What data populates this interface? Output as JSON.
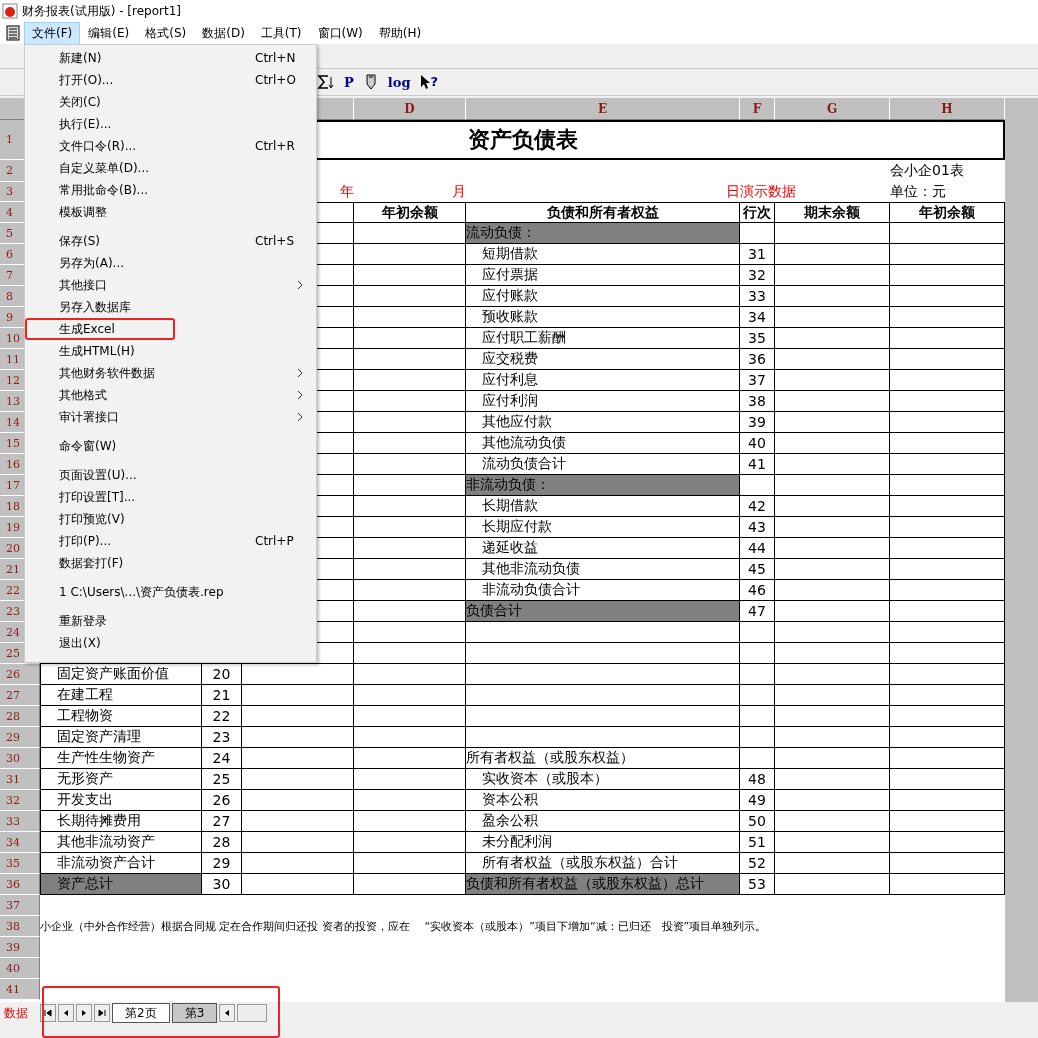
{
  "window": {
    "title": "财务报表(试用版) - [report1]"
  },
  "menubar": [
    {
      "label": "文件(F)",
      "selected": true
    },
    {
      "label": "编辑(E)",
      "selected": false
    },
    {
      "label": "格式(S)",
      "selected": false
    },
    {
      "label": "数据(D)",
      "selected": false
    },
    {
      "label": "工具(T)",
      "selected": false
    },
    {
      "label": "窗口(W)",
      "selected": false
    },
    {
      "label": "帮助(H)",
      "selected": false
    }
  ],
  "toolbar": [
    {
      "kind": "sort"
    },
    {
      "kind": "text",
      "label": "P"
    },
    {
      "kind": "pin"
    },
    {
      "kind": "text",
      "label": "log"
    },
    {
      "kind": "help",
      "label": "?"
    }
  ],
  "file_menu": {
    "groups": [
      [
        {
          "label": "新建(N)",
          "shortcut": "Ctrl+N",
          "submenu": false,
          "annotated": false
        },
        {
          "label": "打开(O)...",
          "shortcut": "Ctrl+O",
          "submenu": false,
          "annotated": false
        },
        {
          "label": "关闭(C)",
          "submenu": false,
          "annotated": false
        },
        {
          "label": "执行(E)...",
          "submenu": false,
          "annotated": false
        },
        {
          "label": "文件口令(R)...",
          "shortcut": "Ctrl+R",
          "submenu": false,
          "annotated": false
        },
        {
          "label": "自定义菜单(D)...",
          "submenu": false,
          "annotated": false
        },
        {
          "label": "常用批命令(B)...",
          "submenu": false,
          "annotated": false
        },
        {
          "label": "模板调整",
          "submenu": false,
          "annotated": false
        }
      ],
      [
        {
          "label": "保存(S)",
          "shortcut": "Ctrl+S",
          "submenu": false,
          "annotated": false
        },
        {
          "label": "另存为(A)...",
          "submenu": false,
          "annotated": false
        },
        {
          "label": "其他接口",
          "submenu": true,
          "annotated": false
        },
        {
          "label": "另存入数据库",
          "submenu": false,
          "annotated": false
        },
        {
          "label": "生成Excel",
          "submenu": false,
          "annotated": true
        },
        {
          "label": "生成HTML(H)",
          "submenu": false,
          "annotated": false
        },
        {
          "label": "其他财务软件数据",
          "submenu": true,
          "annotated": false
        },
        {
          "label": "其他格式",
          "submenu": true,
          "annotated": false
        },
        {
          "label": "审计署接口",
          "submenu": true,
          "annotated": false
        }
      ],
      [
        {
          "label": "命令窗(W)",
          "submenu": false,
          "annotated": false
        }
      ],
      [
        {
          "label": "页面设置(U)...",
          "submenu": false,
          "annotated": false
        },
        {
          "label": "打印设置[T]...",
          "submenu": false,
          "annotated": false
        },
        {
          "label": "打印预览(V)",
          "submenu": false,
          "annotated": false
        },
        {
          "label": "打印(P)...",
          "shortcut": "Ctrl+P",
          "submenu": false,
          "annotated": false
        },
        {
          "label": "数据套打(F)",
          "submenu": false,
          "annotated": false
        }
      ],
      [
        {
          "label": "1 C:\\Users\\...\\资产负债表.rep",
          "submenu": false,
          "annotated": false
        }
      ],
      [
        {
          "label": "重新登录",
          "submenu": false,
          "annotated": false
        },
        {
          "label": "退出(X)",
          "submenu": false,
          "annotated": false
        }
      ]
    ]
  },
  "sheet": {
    "column_headers": [
      "D",
      "E",
      "F",
      "G",
      "H"
    ],
    "rows": [
      {
        "number": "1",
        "kind": "title",
        "text": "资产负债表"
      },
      {
        "number": "2",
        "kind": "info",
        "h": "会小企01表"
      },
      {
        "number": "3",
        "kind": "date",
        "c": "年",
        "d": "月",
        "e": "日",
        "f": "演示数据",
        "h": "单位：元"
      },
      {
        "number": "4",
        "kind": "header",
        "d": "年初余额",
        "e": "负债和所有者权益",
        "f": "行次",
        "g": "期末余额",
        "h": "年初余额"
      },
      {
        "number": "5",
        "kind": "data",
        "right": {
          "label": "流动负债：",
          "kind": "section"
        }
      },
      {
        "number": "6",
        "kind": "data",
        "right": {
          "label": "短期借款",
          "line": "31",
          "kind": "item"
        }
      },
      {
        "number": "7",
        "kind": "data",
        "right": {
          "label": "应付票据",
          "line": "32",
          "kind": "item"
        }
      },
      {
        "number": "8",
        "kind": "data",
        "right": {
          "label": "应付账款",
          "line": "33",
          "kind": "item"
        }
      },
      {
        "number": "9",
        "kind": "data",
        "right": {
          "label": "预收账款",
          "line": "34",
          "kind": "item"
        }
      },
      {
        "number": "10",
        "kind": "data",
        "right": {
          "label": "应付职工薪酬",
          "line": "35",
          "kind": "item"
        }
      },
      {
        "number": "11",
        "kind": "data",
        "right": {
          "label": "应交税费",
          "line": "36",
          "kind": "item"
        }
      },
      {
        "number": "12",
        "kind": "data",
        "right": {
          "label": "应付利息",
          "line": "37",
          "kind": "item"
        }
      },
      {
        "number": "13",
        "kind": "data",
        "right": {
          "label": "应付利润",
          "line": "38",
          "kind": "item"
        }
      },
      {
        "number": "14",
        "kind": "data",
        "right": {
          "label": "其他应付款",
          "line": "39",
          "kind": "item"
        }
      },
      {
        "number": "15",
        "kind": "data",
        "right": {
          "label": "其他流动负债",
          "line": "40",
          "kind": "item"
        }
      },
      {
        "number": "16",
        "kind": "data",
        "right": {
          "label": "流动负债合计",
          "line": "41",
          "kind": "item"
        }
      },
      {
        "number": "17",
        "kind": "data",
        "right": {
          "label": "非流动负债：",
          "kind": "section"
        }
      },
      {
        "number": "18",
        "kind": "data",
        "right": {
          "label": "长期借款",
          "line": "42",
          "kind": "item"
        }
      },
      {
        "number": "19",
        "kind": "data",
        "right": {
          "label": "长期应付款",
          "line": "43",
          "kind": "item"
        }
      },
      {
        "number": "20",
        "kind": "data",
        "right": {
          "label": "递延收益",
          "line": "44",
          "kind": "item"
        }
      },
      {
        "number": "21",
        "kind": "data",
        "right": {
          "label": "其他非流动负债",
          "line": "45",
          "kind": "item"
        }
      },
      {
        "number": "22",
        "kind": "data",
        "right": {
          "label": "非流动负债合计",
          "line": "46",
          "kind": "item"
        }
      },
      {
        "number": "23",
        "kind": "data",
        "right": {
          "label": "负债合计",
          "line": "47",
          "kind": "section"
        }
      },
      {
        "number": "24",
        "kind": "data"
      },
      {
        "number": "25",
        "kind": "data"
      },
      {
        "number": "26",
        "kind": "data",
        "left": {
          "label": "固定资产账面价值",
          "line": "20",
          "kind": "item"
        }
      },
      {
        "number": "27",
        "kind": "data",
        "left": {
          "label": "在建工程",
          "line": "21",
          "kind": "item"
        }
      },
      {
        "number": "28",
        "kind": "data",
        "left": {
          "label": "工程物资",
          "line": "22",
          "kind": "item"
        }
      },
      {
        "number": "29",
        "kind": "data",
        "left": {
          "label": "固定资产清理",
          "line": "23",
          "kind": "item"
        }
      },
      {
        "number": "30",
        "kind": "data",
        "left": {
          "label": "生产性生物资产",
          "line": "24",
          "kind": "item"
        },
        "right": {
          "label": "所有者权益（或股东权益）",
          "kind": "heading"
        }
      },
      {
        "number": "31",
        "kind": "data",
        "left": {
          "label": "无形资产",
          "line": "25",
          "kind": "item"
        },
        "right": {
          "label": "实收资本（或股本）",
          "line": "48",
          "kind": "item"
        }
      },
      {
        "number": "32",
        "kind": "data",
        "left": {
          "label": "开发支出",
          "line": "26",
          "kind": "item"
        },
        "right": {
          "label": "资本公积",
          "line": "49",
          "kind": "item"
        }
      },
      {
        "number": "33",
        "kind": "data",
        "left": {
          "label": "长期待摊费用",
          "line": "27",
          "kind": "item"
        },
        "right": {
          "label": "盈余公积",
          "line": "50",
          "kind": "item"
        }
      },
      {
        "number": "34",
        "kind": "data",
        "left": {
          "label": "其他非流动资产",
          "line": "28",
          "kind": "item"
        },
        "right": {
          "label": "未分配利润",
          "line": "51",
          "kind": "item"
        }
      },
      {
        "number": "35",
        "kind": "data",
        "left": {
          "label": "非流动资产合计",
          "line": "29",
          "kind": "item"
        },
        "right": {
          "label": "所有者权益（或股东权益）合计",
          "line": "52",
          "kind": "item"
        }
      },
      {
        "number": "36",
        "kind": "data",
        "left": {
          "label": "资产总计",
          "line": "30",
          "kind": "total"
        },
        "right": {
          "label": "负债和所有者权益（或股东权益）总计",
          "line": "53",
          "kind": "section"
        }
      },
      {
        "number": "37",
        "kind": "blank"
      },
      {
        "number": "38",
        "kind": "note",
        "text": "小企业（中外合作经营）根据合同规 定在合作期间归还投 资者的投资，应在　 “实收资本（或股本）”项目下增加“减：已归还　投资”项目单独列示。"
      },
      {
        "number": "39",
        "kind": "blank"
      },
      {
        "number": "40",
        "kind": "blank"
      },
      {
        "number": "41",
        "kind": "blank"
      }
    ]
  },
  "sheet_tabs": {
    "label": "数据",
    "tabs": [
      {
        "label": "第2页",
        "selected": true
      },
      {
        "label": "第3",
        "selected": false
      }
    ]
  }
}
